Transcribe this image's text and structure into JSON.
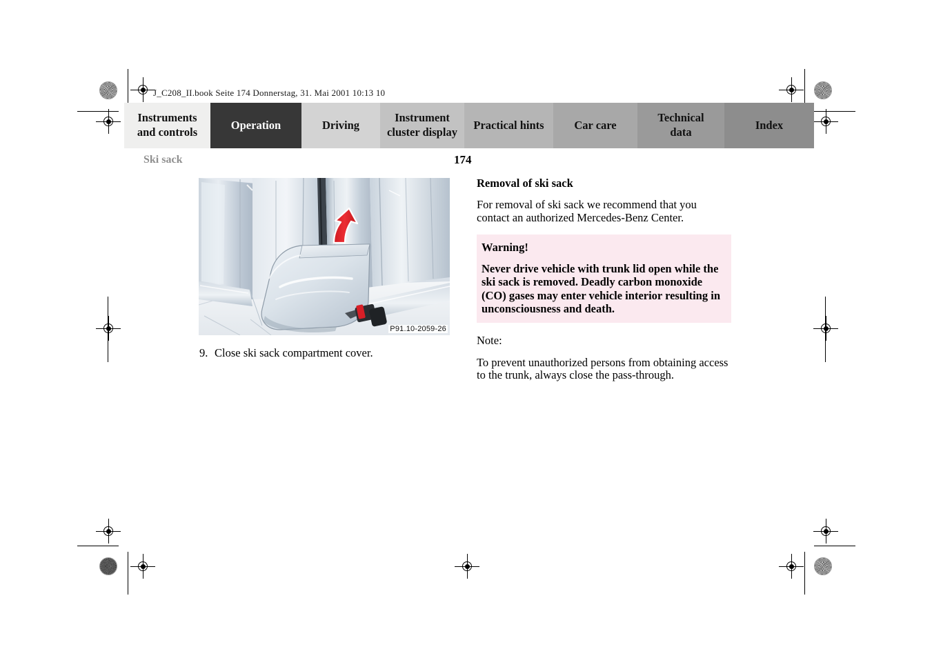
{
  "prepress": {
    "file_info": "J_C208_II.book  Seite 174  Donnerstag, 31. Mai 2001  10:13 10"
  },
  "tabs": [
    {
      "label": "Instruments\nand controls",
      "bg": "#efefee",
      "active": false
    },
    {
      "label": "Operation",
      "bg": "#373737",
      "active": true
    },
    {
      "label": "Driving",
      "bg": "#d3d3d3",
      "active": false
    },
    {
      "label": "Instrument\ncluster display",
      "bg": "#c2c2c2",
      "active": false
    },
    {
      "label": "Practical hints",
      "bg": "#b5b5b5",
      "active": false
    },
    {
      "label": "Car care",
      "bg": "#a8a8a8",
      "active": false
    },
    {
      "label": "Technical\ndata",
      "bg": "#9a9a9a",
      "active": false
    },
    {
      "label": "Index",
      "bg": "#8d8d8d",
      "active": false
    }
  ],
  "header": {
    "section_title": "Ski sack",
    "page_number": "174"
  },
  "figure": {
    "code": "P91.10-2059-26",
    "caption_number": "9.",
    "caption_text": "Close ski sack compartment cover.",
    "arrow_color": "#e2242b"
  },
  "content": {
    "heading": "Removal of ski sack",
    "intro": "For removal of ski sack we recommend that you contact an authorized Mercedes-Benz Center.",
    "warning": {
      "title": "Warning!",
      "body": "Never drive vehicle with trunk lid open while the ski sack is removed. Deadly carbon monoxide (CO) gases may enter vehicle interior resulting in unconsciousness and death.",
      "bg_color": "#fbe9ef"
    },
    "note_label": "Note:",
    "note_body": "To prevent unauthorized persons from obtaining access to the trunk, always close the pass-through."
  }
}
